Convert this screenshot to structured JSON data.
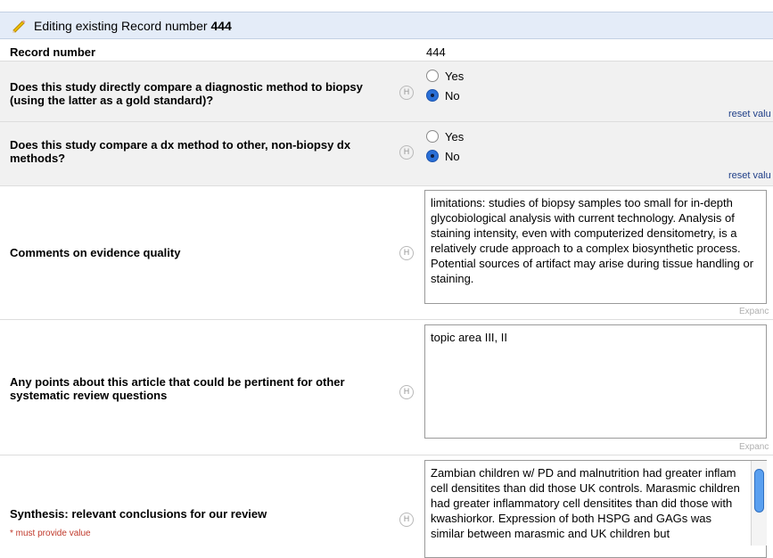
{
  "header": {
    "title_prefix": "Editing existing Record number",
    "record_number": "444"
  },
  "record_row": {
    "label": "Record number",
    "value": "444"
  },
  "help_glyph": "H",
  "questions": [
    {
      "label": "Does this study directly compare a diagnostic method to biopsy (using the latter as a gold standard)?",
      "options": [
        "Yes",
        "No"
      ],
      "selected": "No",
      "reset_label": "reset valu"
    },
    {
      "label": "Does this study compare a dx method to other, non-biopsy dx methods?",
      "options": [
        "Yes",
        "No"
      ],
      "selected": "No",
      "reset_label": "reset valu"
    }
  ],
  "comments": {
    "label": "Comments on evidence quality",
    "value": "limitations: studies of biopsy samples too small for in-depth glycobiological analysis with current technology. Analysis of staining intensity, even with computerized densitometry, is a relatively crude approach to a complex biosynthetic process. Potential sources of artifact may arise during tissue handling or staining.",
    "expand_label": "Expanc"
  },
  "points": {
    "label": "Any points about this article that could be pertinent for other systematic review questions",
    "value": "topic area III, II",
    "expand_label": "Expanc"
  },
  "synthesis": {
    "label": "Synthesis: relevant conclusions for our review",
    "required_note": "* must provide value",
    "value": "Zambian children w/ PD and malnutrition had greater inflam cell densitites than did those UK controls. Marasmic children had greater inflammatory cell densitites than did those with kwashiorkor. Expression of both HSPG and GAGs was similar between marasmic and UK children but"
  },
  "colors": {
    "header_bg": "#e4ecf8",
    "row_shade": "#f1f1f1",
    "accent": "#2a6fd6",
    "required": "#c0392b"
  },
  "icons": {
    "header": "pencil-icon",
    "help": "help-icon"
  }
}
